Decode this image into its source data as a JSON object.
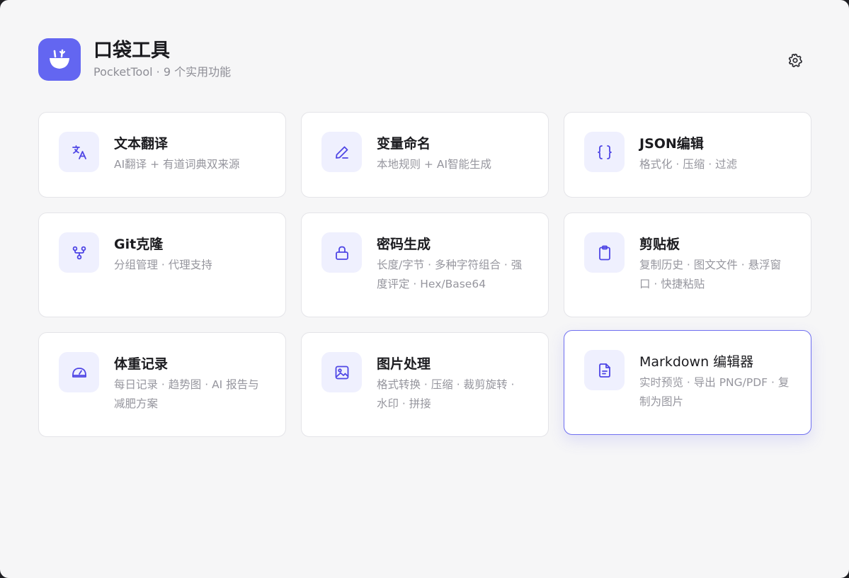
{
  "header": {
    "title": "口袋工具",
    "subtitle": "PocketTool · 9 个实用功能"
  },
  "accent_color": "#6366f1",
  "icon_bg_color": "#eff0fe",
  "tools": [
    {
      "title": "文本翻译",
      "desc": "AI翻译 + 有道词典双来源",
      "icon": "translate-icon"
    },
    {
      "title": "变量命名",
      "desc": "本地规则 + AI智能生成",
      "icon": "pencil-icon"
    },
    {
      "title": "JSON编辑",
      "desc": "格式化 · 压缩 · 过滤",
      "icon": "braces-icon"
    },
    {
      "title": "Git克隆",
      "desc": "分组管理 · 代理支持",
      "icon": "git-branch-icon"
    },
    {
      "title": "密码生成",
      "desc": "长度/字节 · 多种字符组合 · 强度评定 · Hex/Base64",
      "icon": "lock-icon"
    },
    {
      "title": "剪贴板",
      "desc": "复制历史 · 图文文件 · 悬浮窗口 · 快捷粘贴",
      "icon": "clipboard-icon"
    },
    {
      "title": "体重记录",
      "desc": "每日记录 · 趋势图 · AI 报告与减肥方案",
      "icon": "scale-icon"
    },
    {
      "title": "图片处理",
      "desc": "格式转换 · 压缩 · 裁剪旋转 · 水印 · 拼接",
      "icon": "image-icon"
    },
    {
      "title": "Markdown 编辑器",
      "desc": "实时预览 · 导出 PNG/PDF · 复制为图片",
      "icon": "document-icon"
    }
  ]
}
